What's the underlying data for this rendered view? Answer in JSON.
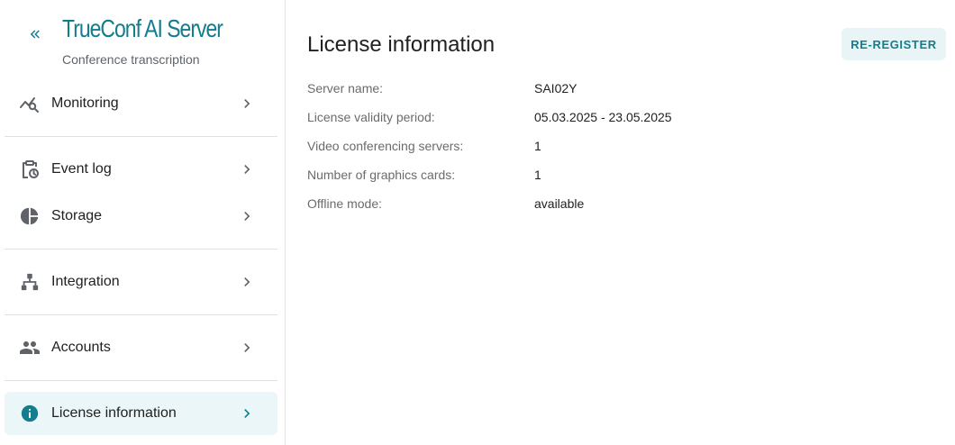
{
  "brand": {
    "title": "TrueConf AI Server",
    "subtitle": "Conference transcription",
    "accent_color": "#137d8e"
  },
  "sidebar": {
    "collapse_icon": "double-chevron-left-icon",
    "items": [
      {
        "label": "Monitoring",
        "icon": "chart-search-icon",
        "active": false
      },
      {
        "label": "Event log",
        "icon": "clipboard-clock-icon",
        "active": false
      },
      {
        "label": "Storage",
        "icon": "pie-chart-icon",
        "active": false
      },
      {
        "label": "Integration",
        "icon": "sitemap-icon",
        "active": false
      },
      {
        "label": "Accounts",
        "icon": "people-icon",
        "active": false
      },
      {
        "label": "License information",
        "icon": "info-icon",
        "active": true
      }
    ]
  },
  "main": {
    "title": "License information",
    "re_register_label": "RE-REGISTER",
    "rows": [
      {
        "label": "Server name:",
        "value": "SAI02Y"
      },
      {
        "label": "License validity period:",
        "value": "05.03.2025 - 23.05.2025"
      },
      {
        "label": "Video conferencing servers:",
        "value": "1"
      },
      {
        "label": "Number of graphics cards:",
        "value": "1"
      },
      {
        "label": "Offline mode:",
        "value": "available"
      }
    ]
  }
}
